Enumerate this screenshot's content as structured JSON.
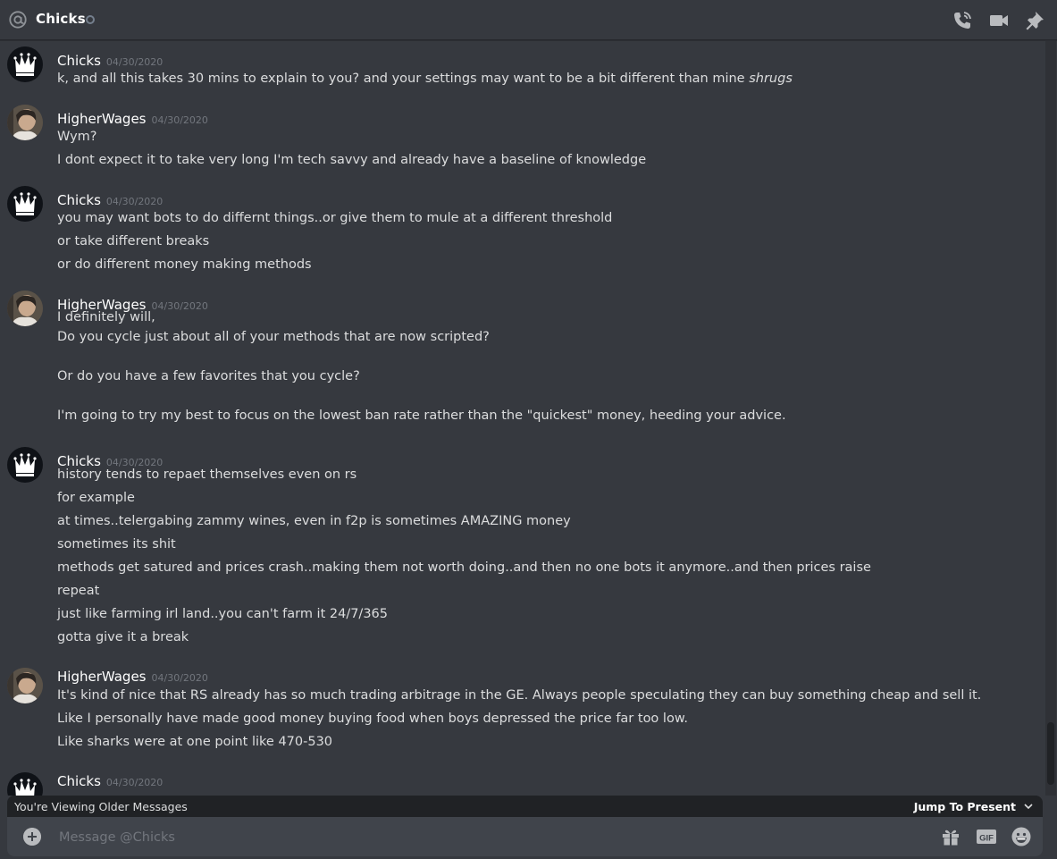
{
  "header": {
    "title": "Chicks",
    "icons": [
      "at-icon",
      "status-icon",
      "voice-call-icon",
      "video-call-icon",
      "pin-icon"
    ]
  },
  "messages": [
    {
      "author": "Chicks",
      "avatar": "crown",
      "timestamp": "04/30/2020",
      "lines": [
        {
          "text": "k, and all this takes 30 mins to explain to you? and your settings may want to be a bit different than mine ",
          "italic": "shrugs"
        }
      ]
    },
    {
      "author": "HigherWages",
      "avatar": "face",
      "timestamp": "04/30/2020",
      "lines": [
        {
          "text": "Wym?"
        },
        {
          "text": "I dont expect it to take very long I'm tech savvy and already have a baseline of knowledge"
        }
      ]
    },
    {
      "author": "Chicks",
      "avatar": "crown",
      "timestamp": "04/30/2020",
      "lines": [
        {
          "text": "you may want bots to do differnt things..or give them to mule at a different threshold"
        },
        {
          "text": "or take different breaks"
        },
        {
          "text": "or do different money making methods"
        }
      ]
    },
    {
      "author": "HigherWages",
      "avatar": "face",
      "timestamp": "04/30/2020",
      "lines": [
        {
          "text": "I definitely will,"
        },
        {
          "text": "Do you cycle just about all of your methods that are now scripted?"
        },
        {
          "text": "Or do you have a few favorites that you cycle?"
        },
        {
          "text": "I'm going to try my best to focus on the lowest ban rate rather than the \"quickest\" money, heeding your advice."
        }
      ]
    },
    {
      "author": "Chicks",
      "avatar": "crown",
      "timestamp": "04/30/2020",
      "lines": [
        {
          "text": "history tends to repaet themselves even on rs"
        },
        {
          "text": "for example"
        },
        {
          "text": "at times..telergabing zammy wines, even in f2p is sometimes AMAZING money"
        },
        {
          "text": "sometimes its shit"
        },
        {
          "text": "methods get satured and prices crash..making them not worth doing..and then no one bots it anymore..and then prices raise"
        },
        {
          "text": "repeat"
        },
        {
          "text": "just like farming irl land..you can't farm it 24/7/365"
        },
        {
          "text": "gotta give it a break"
        }
      ]
    },
    {
      "author": "HigherWages",
      "avatar": "face",
      "timestamp": "04/30/2020",
      "lines": [
        {
          "text": "It's kind of nice that RS already has so much trading arbitrage in the GE. Always people speculating they can buy something cheap and sell it."
        },
        {
          "text": "Like I personally have made good money buying food when boys depressed the price far too low."
        },
        {
          "text": "Like sharks were at one point like 470-530"
        }
      ]
    },
    {
      "author": "Chicks",
      "avatar": "crown",
      "timestamp": "04/30/2020",
      "lines": []
    }
  ],
  "older_bar": {
    "text": "You're Viewing Older Messages",
    "jump_label": "Jump To Present"
  },
  "composer": {
    "placeholder": "Message @Chicks",
    "value": "",
    "icons": [
      "add-attachment-icon",
      "gift-icon",
      "gif-icon",
      "emoji-icon"
    ]
  },
  "colors": {
    "background": "#36393f",
    "composer": "#40444b",
    "bar": "#202225",
    "author": "#ffffff",
    "timestamp": "#72767d",
    "text": "#dcddde"
  }
}
